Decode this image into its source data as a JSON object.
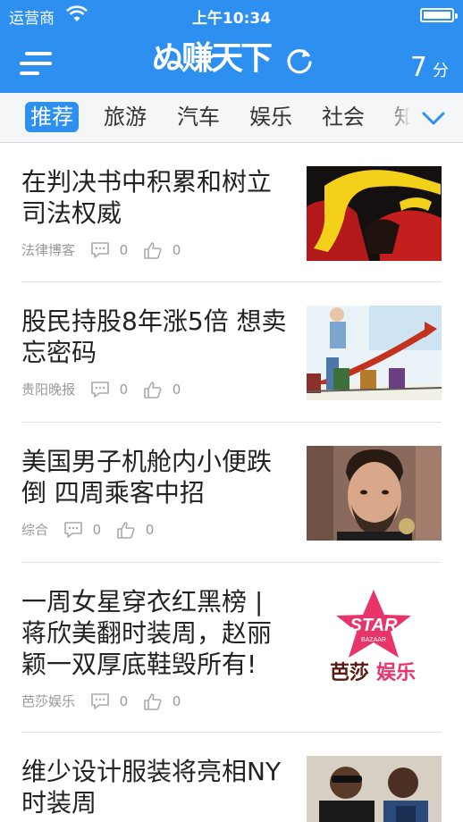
{
  "status_bar": {
    "carrier": "运营商",
    "time": "上午10:34"
  },
  "header": {
    "logo_text": "ぬ赚天下",
    "countdown_value": "7",
    "countdown_unit": "分"
  },
  "tabs": [
    {
      "label": "推荐",
      "active": true
    },
    {
      "label": "旅游"
    },
    {
      "label": "汽车"
    },
    {
      "label": "娱乐"
    },
    {
      "label": "社会"
    },
    {
      "label": "知"
    }
  ],
  "feed": [
    {
      "title": "在判决书中积累和树立司法权威",
      "source": "法律博客",
      "comments": "0",
      "likes": "0",
      "thumb": "red-black-abstract"
    },
    {
      "title": "股民持股8年涨5倍 想卖忘密码",
      "source": "贵阳晚报",
      "comments": "0",
      "likes": "0",
      "thumb": "stock-cartoon"
    },
    {
      "title": "美国男子机舱内小便跌倒 四周乘客中招",
      "source": "综合",
      "comments": "0",
      "likes": "0",
      "thumb": "man-portrait"
    },
    {
      "title": "一周女星穿衣红黑榜 | 蒋欣美翻时装周，赵丽颖一双厚底鞋毁所有!",
      "source": "芭莎娱乐",
      "comments": "0",
      "likes": "0",
      "thumb": "star-bazaar-logo",
      "thumb_text": {
        "star": "STAR",
        "sub": "BAZAAR",
        "bottom_a": "芭莎",
        "bottom_b": "娱乐"
      }
    },
    {
      "title": "维少设计服装将亮相NY时装周",
      "source": "",
      "comments": "",
      "likes": "",
      "thumb": "two-men-photo"
    }
  ],
  "colors": {
    "brand_blue": "#2d8ff0",
    "text": "#222222",
    "meta": "#999999"
  }
}
